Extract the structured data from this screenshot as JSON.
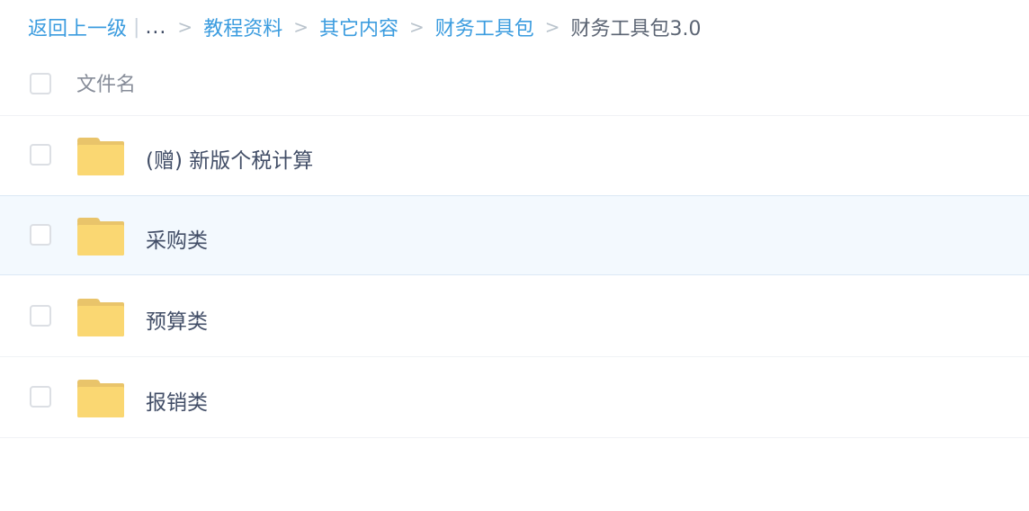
{
  "breadcrumb": {
    "back_label": "返回上一级",
    "pipe": "|",
    "ellipsis": "...",
    "separator": ">",
    "items": [
      "教程资料",
      "其它内容",
      "财务工具包"
    ],
    "current": "财务工具包3.0"
  },
  "list": {
    "header_label": "文件名",
    "rows": [
      {
        "name": "(赠) 新版个税计算",
        "type": "folder"
      },
      {
        "name": "采购类",
        "type": "folder"
      },
      {
        "name": "预算类",
        "type": "folder"
      },
      {
        "name": "报销类",
        "type": "folder"
      }
    ]
  },
  "colors": {
    "link": "#3b9cdf",
    "folder_back": "#e9c46a",
    "folder_front": "#fad772",
    "hover_row": "#f3f9fe"
  },
  "icons": {
    "folder": "folder-icon"
  }
}
